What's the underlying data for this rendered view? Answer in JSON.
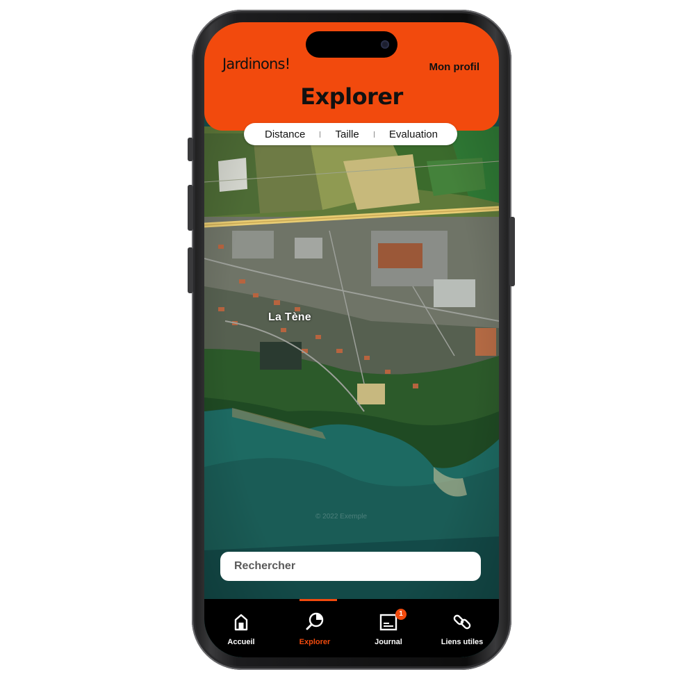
{
  "header": {
    "brand": "Jardinons!",
    "profile_label": "Mon profil",
    "title": "Explorer"
  },
  "filters": [
    {
      "label": "Distance"
    },
    {
      "label": "Taille"
    },
    {
      "label": "Evaluation"
    }
  ],
  "map": {
    "place_label": "La Tène",
    "attribution": "© 2022 Exemple"
  },
  "search": {
    "placeholder": "Rechercher"
  },
  "nav": {
    "items": [
      {
        "label": "Accueil",
        "icon": "home-icon"
      },
      {
        "label": "Explorer",
        "icon": "explore-icon",
        "active": true
      },
      {
        "label": "Journal",
        "icon": "journal-icon",
        "badge": "1"
      },
      {
        "label": "Liens utiles",
        "icon": "link-icon"
      }
    ]
  },
  "colors": {
    "accent": "#f24a0d",
    "nav_background": "#000000",
    "header_text": "#111111"
  }
}
